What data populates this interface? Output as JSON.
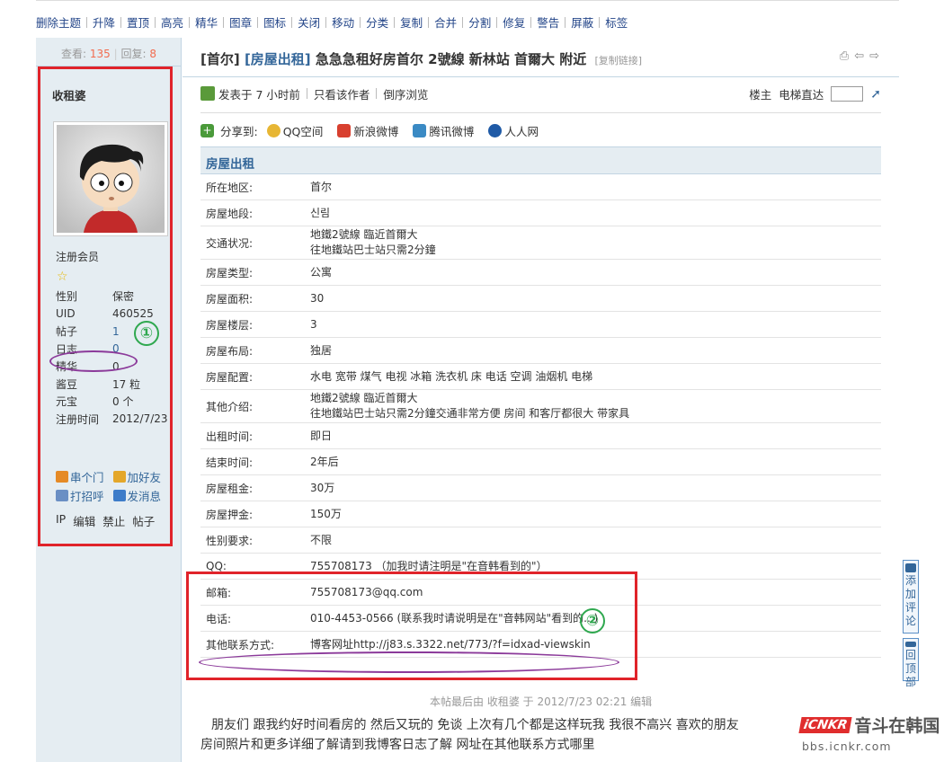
{
  "toolbar": {
    "items": [
      "删除主题",
      "升降",
      "置顶",
      "高亮",
      "精华",
      "图章",
      "图标",
      "关闭",
      "移动",
      "分类",
      "复制",
      "合并",
      "分割",
      "修复",
      "警告",
      "屏蔽",
      "标签"
    ]
  },
  "sidebar": {
    "view_label": "查看:",
    "view_count": "135",
    "reply_label": "回复:",
    "reply_count": "8",
    "username": "收租婆",
    "group": "注册会员",
    "info": [
      {
        "k": "性别",
        "v": "保密",
        "blue": false
      },
      {
        "k": "UID",
        "v": "460525",
        "blue": false
      },
      {
        "k": "帖子",
        "v": "1",
        "blue": true
      },
      {
        "k": "日志",
        "v": "0",
        "blue": true
      },
      {
        "k": "精华",
        "v": "0",
        "blue": false
      },
      {
        "k": "酱豆",
        "v": "17 粒",
        "blue": false
      },
      {
        "k": "元宝",
        "v": "0 个",
        "blue": false
      },
      {
        "k": "注册时间",
        "v": "2012/7/23",
        "blue": false
      }
    ],
    "actions_row1": [
      "串个门",
      "加好友"
    ],
    "actions_row2": [
      "打招呼",
      "发消息"
    ],
    "admin_links": [
      "IP",
      "编辑",
      "禁止",
      "帖子"
    ]
  },
  "annotations": {
    "one": "①",
    "two": "②"
  },
  "post": {
    "title_prefix": "[首尔]",
    "title_category": "[房屋出租]",
    "title_text": "急急急租好房首尔 2號線 新林站 首爾大 附近",
    "copy_link": "[复制链接]",
    "posted": "发表于 7 小时前",
    "only_author": "只看该作者",
    "reverse": "倒序浏览",
    "floor": "楼主",
    "elevator": "电梯直达",
    "share_label": "分享到:",
    "share_targets": [
      "QQ空间",
      "新浪微博",
      "腾讯微博",
      "人人网"
    ],
    "section_title": "房屋出租",
    "rows": [
      {
        "k": "所在地区:",
        "v1": "首尔",
        "v2": ""
      },
      {
        "k": "房屋地段:",
        "v1": "신림",
        "v2": ""
      },
      {
        "k": "交通状况:",
        "v1": "地鐵2號線 臨近首爾大",
        "v2": "往地鐵站巴士站只需2分鐘"
      },
      {
        "k": "房屋类型:",
        "v1": "公寓",
        "v2": ""
      },
      {
        "k": "房屋面积:",
        "v1": "30",
        "v2": ""
      },
      {
        "k": "房屋楼层:",
        "v1": "3",
        "v2": ""
      },
      {
        "k": "房屋布局:",
        "v1": "独居",
        "v2": ""
      },
      {
        "k": "房屋配置:",
        "v1": "水电 宽带 煤气 电视 冰箱 洗衣机 床 电话 空调 油烟机 电梯",
        "v2": ""
      },
      {
        "k": "其他介绍:",
        "v1": "地鐵2號線 臨近首爾大",
        "v2": "往地鐵站巴士站只需2分鐘交通非常方便 房间 和客厅都很大 带家具"
      },
      {
        "k": "出租时间:",
        "v1": "即日",
        "v2": ""
      },
      {
        "k": "结束时间:",
        "v1": "2年后",
        "v2": ""
      },
      {
        "k": "房屋租金:",
        "v1": "30万",
        "v2": ""
      },
      {
        "k": "房屋押金:",
        "v1": "150万",
        "v2": ""
      },
      {
        "k": "性别要求:",
        "v1": "不限",
        "v2": ""
      },
      {
        "k": "QQ:",
        "v1": "755708173 （加我时请注明是\"在音韩看到的\"）",
        "v2": ""
      },
      {
        "k": "邮箱:",
        "v1": "755708173@qq.com",
        "v2": ""
      },
      {
        "k": "电话:",
        "v1": "010-4453-0566 (联系我时请说明是在\"音韩网站\"看到的...)",
        "v2": ""
      },
      {
        "k": "其他联系方式:",
        "v1": "博客网址http://j83.s.3322.net/773/?f=idxad-viewskin",
        "v2": ""
      }
    ],
    "edited_note": "本帖最后由 收租婆 于 2012/7/23 02:21 编辑",
    "body_line1": "朋友们 跟我约好时间看房的 然后又玩的 免谈  上次有几个都是这样玩我 我很不高兴  喜欢的朋友",
    "body_line2": "房间照片和更多详细了解请到我博客日志了解 网址在其他联系方式哪里"
  },
  "floating": {
    "add_comment": [
      "添",
      "加",
      "评",
      "论"
    ],
    "back_top": [
      "回",
      "顶",
      "部"
    ]
  },
  "watermark": {
    "logo": "iCNKR",
    "korean": "音斗在韩国",
    "url": "bbs.icnkr.com"
  }
}
